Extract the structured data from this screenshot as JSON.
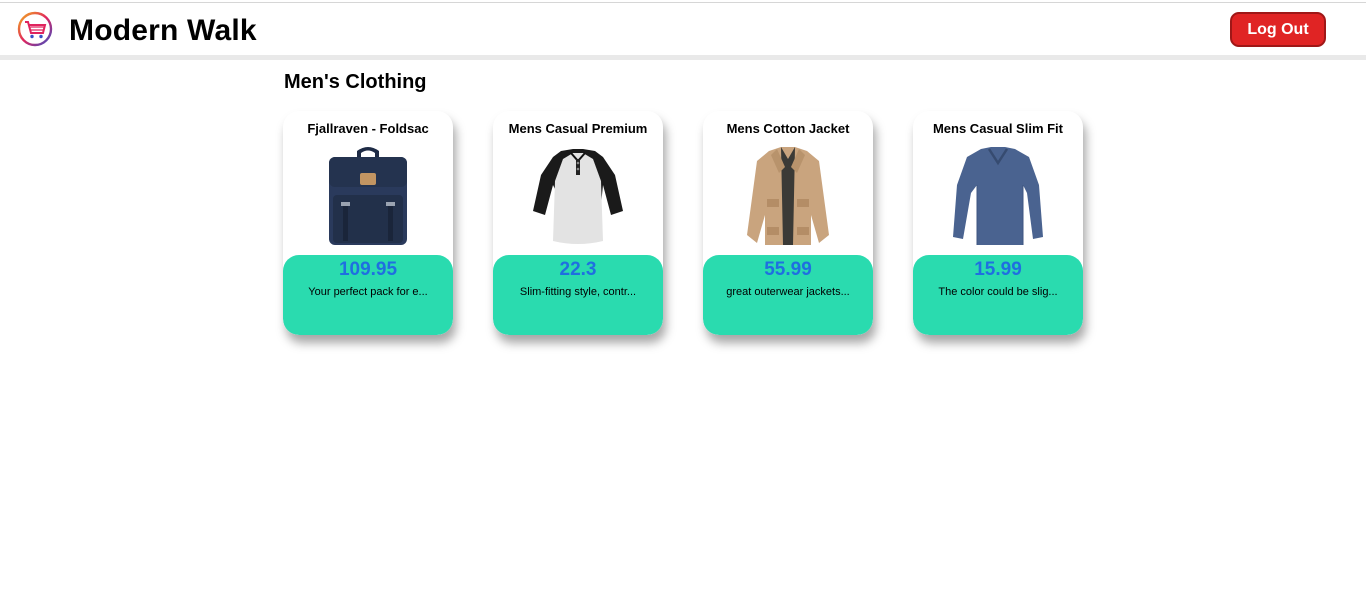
{
  "header": {
    "brand": "Modern Walk",
    "logout_label": "Log Out",
    "logo_icon": "shopping-cart-icon"
  },
  "section": {
    "title": "Men's Clothing"
  },
  "products": [
    {
      "title": "Fjallraven - Foldsac",
      "price": "109.95",
      "description": "Your perfect pack for e...",
      "image_icon": "backpack-image"
    },
    {
      "title": "Mens Casual Premium",
      "price": "22.3",
      "description": "Slim-fitting style, contr...",
      "image_icon": "raglan-tshirt-image"
    },
    {
      "title": "Mens Cotton Jacket",
      "price": "55.99",
      "description": "great outerwear jackets...",
      "image_icon": "cotton-jacket-image"
    },
    {
      "title": "Mens Casual Slim Fit",
      "price": "15.99",
      "description": "The color could be slig...",
      "image_icon": "slim-fit-shirt-image"
    }
  ],
  "colors": {
    "accent": "#2adbaf",
    "price": "#1f6fe0",
    "logout": "#e02424"
  }
}
